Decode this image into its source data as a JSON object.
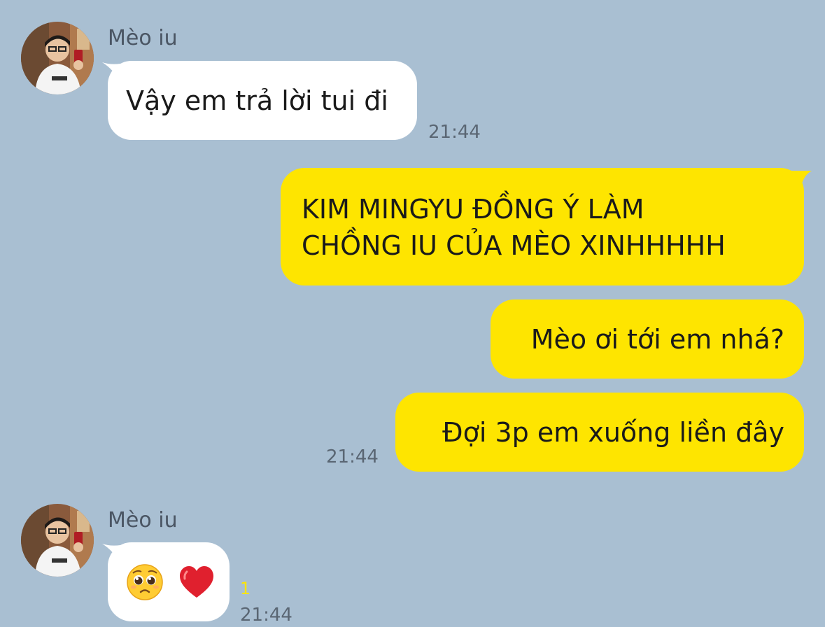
{
  "messages": [
    {
      "direction": "incoming",
      "sender": "Mèo iu",
      "text": "Vậy em trả lời tui đi",
      "time": "21:44"
    },
    {
      "direction": "outgoing",
      "lines": [
        "KIM MINGYU ĐỒNG Ý LÀM",
        "CHỒNG IU CỦA MÈO XINHHHHH"
      ]
    },
    {
      "direction": "outgoing",
      "text": "Mèo ơi tới em nhá?"
    },
    {
      "direction": "outgoing",
      "text": "Đợi 3p em xuống liền đây",
      "time": "21:44"
    },
    {
      "direction": "incoming",
      "sender": "Mèo iu",
      "emojis": [
        "pleading-face",
        "red-heart"
      ],
      "unread": "1",
      "time": "21:44"
    }
  ],
  "colors": {
    "background": "#a9bfd2",
    "incoming_bubble": "#ffffff",
    "outgoing_bubble": "#fee500",
    "timestamp": "#5a6673",
    "unread": "#fee500"
  }
}
